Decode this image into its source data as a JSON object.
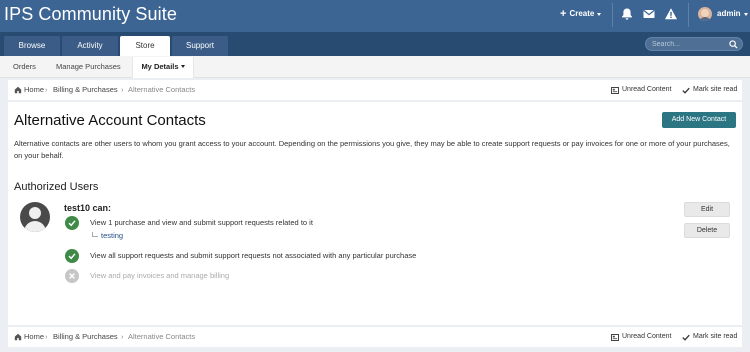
{
  "header": {
    "brand": "IPS Community Suite",
    "create_label": "Create",
    "user_name": "admin",
    "icons": [
      "plus-icon",
      "bell-icon",
      "envelope-icon",
      "warning-icon"
    ],
    "colors": {
      "header_bg": "#3d6594",
      "nav_bg": "#284b72",
      "accent": "#2b7682",
      "success": "#3e8a46"
    }
  },
  "nav": {
    "tabs": [
      {
        "label": "Browse"
      },
      {
        "label": "Activity"
      },
      {
        "label": "Store",
        "active": true
      },
      {
        "label": "Support"
      }
    ],
    "search_placeholder": "Search..."
  },
  "subnav": {
    "items": [
      {
        "label": "Orders"
      },
      {
        "label": "Manage Purchases"
      },
      {
        "label": "My Details",
        "active": true
      }
    ]
  },
  "breadcrumb": {
    "home": "Home",
    "billing": "Billing & Purchases",
    "current": "Alternative Contacts",
    "sep": "›",
    "unread": "Unread Content",
    "mark_read": "Mark site read"
  },
  "main": {
    "title": "Alternative Account Contacts",
    "add_button": "Add New Contact",
    "intro": "Alternative contacts are other users to whom you grant access to your account. Depending on the permissions you give, they may be able to create support requests or pay invoices for one or more of your purchases, on your behalf.",
    "section_title": "Authorized Users",
    "user": {
      "name": "test10 can:",
      "permissions": [
        {
          "text": "View 1 purchase and view and submit support requests related to it",
          "granted": true
        },
        {
          "text": "View all support requests and submit support requests not associated with any particular purchase",
          "granted": true
        },
        {
          "text": "View and pay invoices and manage billing",
          "granted": false
        }
      ],
      "purchase": "testing",
      "edit_label": "Edit",
      "delete_label": "Delete"
    }
  }
}
